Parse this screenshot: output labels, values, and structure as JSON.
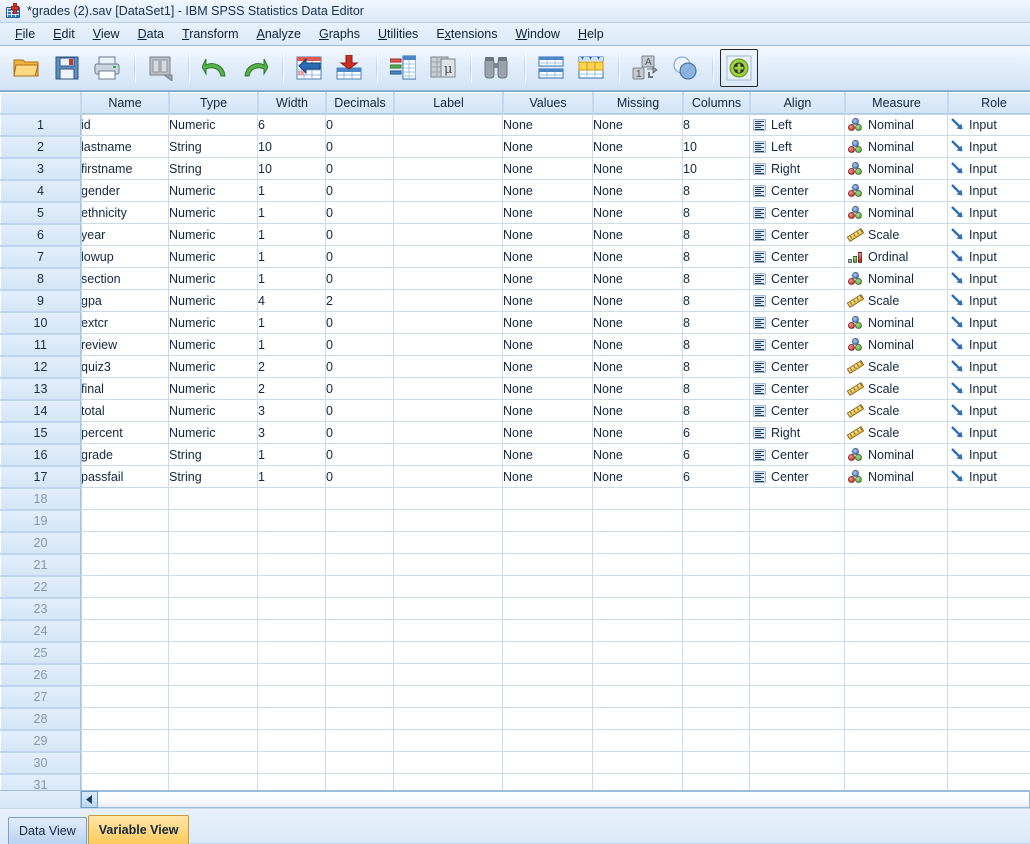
{
  "window": {
    "title": "*grades (2).sav [DataSet1] - IBM SPSS Statistics Data Editor",
    "icon": "spss-app-icon"
  },
  "menubar": {
    "items": [
      {
        "label": "File",
        "mnemonic": "F"
      },
      {
        "label": "Edit",
        "mnemonic": "E"
      },
      {
        "label": "View",
        "mnemonic": "V"
      },
      {
        "label": "Data",
        "mnemonic": "D"
      },
      {
        "label": "Transform",
        "mnemonic": "T"
      },
      {
        "label": "Analyze",
        "mnemonic": "A"
      },
      {
        "label": "Graphs",
        "mnemonic": "G"
      },
      {
        "label": "Utilities",
        "mnemonic": "U"
      },
      {
        "label": "Extensions",
        "mnemonic": "x"
      },
      {
        "label": "Window",
        "mnemonic": "W"
      },
      {
        "label": "Help",
        "mnemonic": "H"
      }
    ]
  },
  "toolbar": {
    "buttons": [
      {
        "name": "open-file-icon",
        "title": "Open data document"
      },
      {
        "name": "save-file-icon",
        "title": "Save this document"
      },
      {
        "name": "print-icon",
        "title": "Print"
      },
      {
        "name": "recall-dialog-icon",
        "title": "Recall recently used dialogs"
      },
      {
        "name": "undo-icon",
        "title": "Undo a user action"
      },
      {
        "name": "redo-icon",
        "title": "Redo a user action"
      },
      {
        "name": "goto-case-icon",
        "title": "Go to case"
      },
      {
        "name": "goto-variable-icon",
        "title": "Go to variable"
      },
      {
        "name": "variables-icon",
        "title": "Variables"
      },
      {
        "name": "run-descriptives-icon",
        "title": "Run descriptive statistics"
      },
      {
        "name": "find-icon",
        "title": "Find"
      },
      {
        "name": "split-file-icon",
        "title": "Split file"
      },
      {
        "name": "weight-cases-icon",
        "title": "Weight cases"
      },
      {
        "name": "value-labels-icon",
        "title": "Value labels"
      },
      {
        "name": "select-cases-icon",
        "title": "Select cases"
      },
      {
        "name": "insert-variable-icon",
        "title": "Insert variable",
        "pressed": true
      }
    ]
  },
  "grid": {
    "columns": [
      "Name",
      "Type",
      "Width",
      "Decimals",
      "Label",
      "Values",
      "Missing",
      "Columns",
      "Align",
      "Measure",
      "Role"
    ],
    "rows": [
      {
        "n": "1",
        "name": "id",
        "type": "Numeric",
        "width": "6",
        "decimals": "0",
        "label": "",
        "values": "None",
        "missing": "None",
        "columns": "8",
        "align": "Left",
        "measure": "Nominal",
        "role": "Input"
      },
      {
        "n": "2",
        "name": "lastname",
        "type": "String",
        "width": "10",
        "decimals": "0",
        "label": "",
        "values": "None",
        "missing": "None",
        "columns": "10",
        "align": "Left",
        "measure": "Nominal",
        "role": "Input"
      },
      {
        "n": "3",
        "name": "firstname",
        "type": "String",
        "width": "10",
        "decimals": "0",
        "label": "",
        "values": "None",
        "missing": "None",
        "columns": "10",
        "align": "Right",
        "measure": "Nominal",
        "role": "Input"
      },
      {
        "n": "4",
        "name": "gender",
        "type": "Numeric",
        "width": "1",
        "decimals": "0",
        "label": "",
        "values": "None",
        "missing": "None",
        "columns": "8",
        "align": "Center",
        "measure": "Nominal",
        "role": "Input"
      },
      {
        "n": "5",
        "name": "ethnicity",
        "type": "Numeric",
        "width": "1",
        "decimals": "0",
        "label": "",
        "values": "None",
        "missing": "None",
        "columns": "8",
        "align": "Center",
        "measure": "Nominal",
        "role": "Input"
      },
      {
        "n": "6",
        "name": "year",
        "type": "Numeric",
        "width": "1",
        "decimals": "0",
        "label": "",
        "values": "None",
        "missing": "None",
        "columns": "8",
        "align": "Center",
        "measure": "Scale",
        "role": "Input"
      },
      {
        "n": "7",
        "name": "lowup",
        "type": "Numeric",
        "width": "1",
        "decimals": "0",
        "label": "",
        "values": "None",
        "missing": "None",
        "columns": "8",
        "align": "Center",
        "measure": "Ordinal",
        "role": "Input"
      },
      {
        "n": "8",
        "name": "section",
        "type": "Numeric",
        "width": "1",
        "decimals": "0",
        "label": "",
        "values": "None",
        "missing": "None",
        "columns": "8",
        "align": "Center",
        "measure": "Nominal",
        "role": "Input"
      },
      {
        "n": "9",
        "name": "gpa",
        "type": "Numeric",
        "width": "4",
        "decimals": "2",
        "label": "",
        "values": "None",
        "missing": "None",
        "columns": "8",
        "align": "Center",
        "measure": "Scale",
        "role": "Input"
      },
      {
        "n": "10",
        "name": "extcr",
        "type": "Numeric",
        "width": "1",
        "decimals": "0",
        "label": "",
        "values": "None",
        "missing": "None",
        "columns": "8",
        "align": "Center",
        "measure": "Nominal",
        "role": "Input"
      },
      {
        "n": "11",
        "name": "review",
        "type": "Numeric",
        "width": "1",
        "decimals": "0",
        "label": "",
        "values": "None",
        "missing": "None",
        "columns": "8",
        "align": "Center",
        "measure": "Nominal",
        "role": "Input"
      },
      {
        "n": "12",
        "name": "quiz3",
        "type": "Numeric",
        "width": "2",
        "decimals": "0",
        "label": "",
        "values": "None",
        "missing": "None",
        "columns": "8",
        "align": "Center",
        "measure": "Scale",
        "role": "Input"
      },
      {
        "n": "13",
        "name": "final",
        "type": "Numeric",
        "width": "2",
        "decimals": "0",
        "label": "",
        "values": "None",
        "missing": "None",
        "columns": "8",
        "align": "Center",
        "measure": "Scale",
        "role": "Input"
      },
      {
        "n": "14",
        "name": "total",
        "type": "Numeric",
        "width": "3",
        "decimals": "0",
        "label": "",
        "values": "None",
        "missing": "None",
        "columns": "8",
        "align": "Center",
        "measure": "Scale",
        "role": "Input"
      },
      {
        "n": "15",
        "name": "percent",
        "type": "Numeric",
        "width": "3",
        "decimals": "0",
        "label": "",
        "values": "None",
        "missing": "None",
        "columns": "6",
        "align": "Right",
        "measure": "Scale",
        "role": "Input"
      },
      {
        "n": "16",
        "name": "grade",
        "type": "String",
        "width": "1",
        "decimals": "0",
        "label": "",
        "values": "None",
        "missing": "None",
        "columns": "6",
        "align": "Center",
        "measure": "Nominal",
        "role": "Input"
      },
      {
        "n": "17",
        "name": "passfail",
        "type": "String",
        "width": "1",
        "decimals": "0",
        "label": "",
        "values": "None",
        "missing": "None",
        "columns": "6",
        "align": "Center",
        "measure": "Nominal",
        "role": "Input"
      }
    ],
    "empty_rows": [
      "18",
      "19",
      "20",
      "21",
      "22",
      "23",
      "24",
      "25",
      "26",
      "27",
      "28",
      "29",
      "30",
      "31"
    ]
  },
  "scrollbar": {
    "left_arrow": "scroll-left-icon"
  },
  "tabs": [
    {
      "label": "Data View",
      "active": false
    },
    {
      "label": "Variable View",
      "active": true
    }
  ],
  "colors": {
    "header_blue": "#d3e5f8",
    "active_tab_orange": "#ffc95c",
    "inactive_tab_blue": "#b9d3ef",
    "grid_line": "#c9dcee",
    "text": "#12283f"
  }
}
